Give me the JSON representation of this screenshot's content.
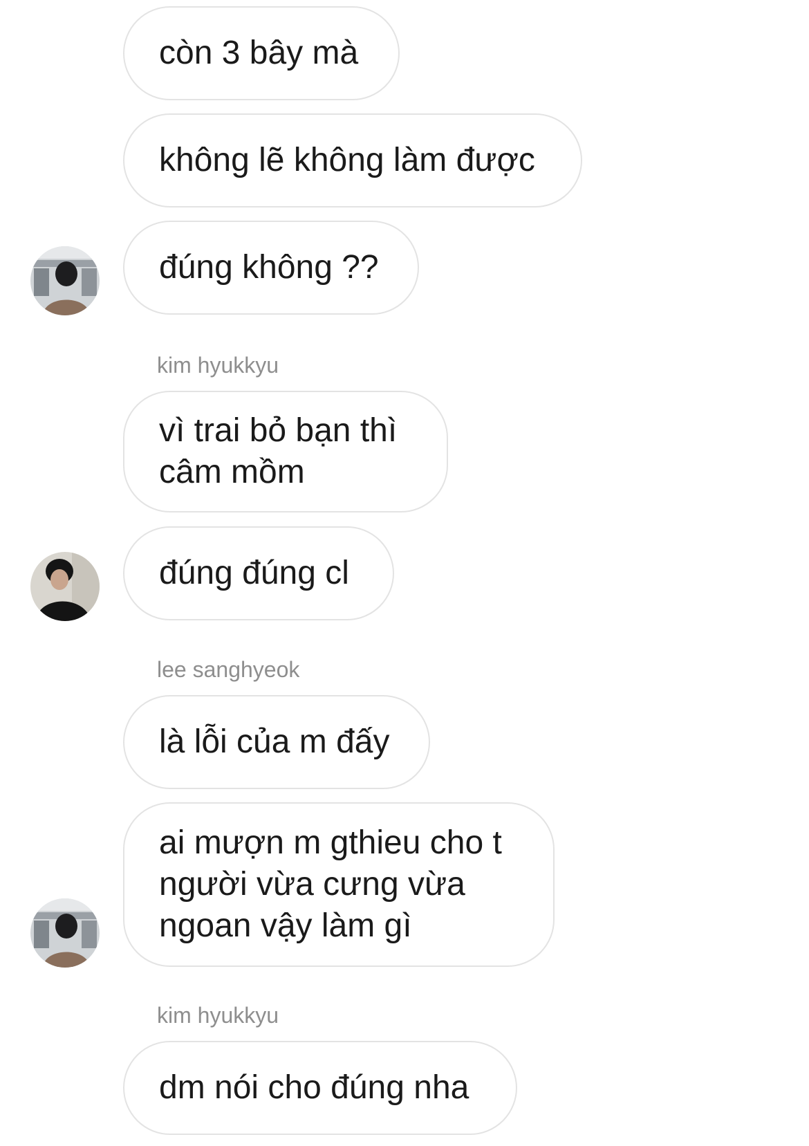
{
  "conversation": {
    "messages": [
      {
        "text": "còn 3 bây mà"
      },
      {
        "text": "không lẽ không làm được"
      },
      {
        "text": "đúng không ??"
      },
      {
        "sender": "kim hyukkyu",
        "text": "vì trai bỏ bạn thì\ncâm mồm"
      },
      {
        "text": "đúng đúng cl"
      },
      {
        "sender": "lee sanghyeok",
        "text": "là lỗi của m đấy"
      },
      {
        "text": "ai mượn m gthieu cho t\nngười vừa cưng vừa\nngoan vậy làm gì"
      },
      {
        "sender": "kim hyukkyu",
        "text": "dm nói cho đúng nha"
      }
    ]
  },
  "colors": {
    "bubble_border": "#e3e3e3",
    "sender_label": "#8e8e8e",
    "text": "#1a1a1a"
  }
}
